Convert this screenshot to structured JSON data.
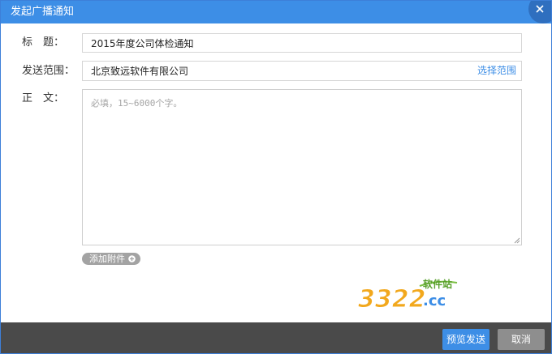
{
  "dialog": {
    "title": "发起广播通知",
    "close_icon": "close-icon"
  },
  "form": {
    "title_label": "标　题：",
    "title_value": "2015年度公司体检通知",
    "recipients_label": "发送范围：",
    "recipients_value": "北京致远软件有限公司",
    "select_range_link": "选择范围",
    "body_label": "正　文：",
    "body_placeholder": "必填，15~6000个字。",
    "attach_button": "添加附件",
    "attach_icon": "plus-circle-icon"
  },
  "watermark": {
    "text_main": "3322",
    "text_suffix": ".cc",
    "text_tag": "软件站"
  },
  "footer": {
    "preview_send_button": "预览发送",
    "cancel_button": "取消"
  },
  "colors": {
    "primary": "#3d8ee6",
    "footer_bg": "#4a4a4a",
    "secondary_button": "#8e8e8e",
    "link": "#3d8ee6"
  }
}
